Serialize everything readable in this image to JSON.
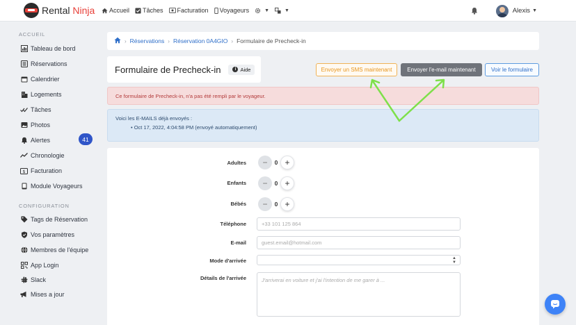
{
  "brand": {
    "name_part1": "Rental",
    "name_part2": "Ninja"
  },
  "topnav": {
    "home": "Accueil",
    "tasks": "Tâches",
    "billing": "Facturation",
    "guests": "Voyageurs"
  },
  "user": {
    "name": "Alexis"
  },
  "sidebar": {
    "section_accueil": "ACCUEIL",
    "section_config": "CONFIGURATION",
    "items": [
      {
        "label": "Tableau de bord",
        "icon": "bar-chart-icon"
      },
      {
        "label": "Réservations",
        "icon": "list-icon"
      },
      {
        "label": "Calendrier",
        "icon": "calendar-icon"
      },
      {
        "label": "Logements",
        "icon": "building-icon"
      },
      {
        "label": "Tâches",
        "icon": "check-icon"
      },
      {
        "label": "Photos",
        "icon": "image-icon"
      },
      {
        "label": "Alertes",
        "icon": "bell-icon",
        "badge": "41"
      },
      {
        "label": "Chronologie",
        "icon": "timeline-icon"
      },
      {
        "label": "Facturation",
        "icon": "money-icon"
      },
      {
        "label": "Module Voyageurs",
        "icon": "tablet-icon"
      }
    ],
    "config_items": [
      {
        "label": "Tags de Réservation",
        "icon": "tag-icon"
      },
      {
        "label": "Vos paramètres",
        "icon": "shield-icon"
      },
      {
        "label": "Membres de l'équipe",
        "icon": "globe-icon"
      },
      {
        "label": "App Login",
        "icon": "qr-icon"
      },
      {
        "label": "Slack",
        "icon": "slack-icon"
      },
      {
        "label": "Mises a jour",
        "icon": "megaphone-icon"
      }
    ]
  },
  "breadcrumb": {
    "reservations": "Réservations",
    "reservation": "Réservation 0A4GIO",
    "current": "Formulaire de Precheck-in"
  },
  "page": {
    "title": "Formulaire de Precheck-in",
    "help": "Aide",
    "btn_sms": "Envoyer un SMS maintenant",
    "btn_email": "Envoyer l'e-mail maintenant",
    "btn_view": "Voir le formulaire"
  },
  "alerts": {
    "danger": "Ce formulaire de Precheck-in, n'a pas été rempli par le voyageur.",
    "info_title": "Voici les E-MAILS déjà envoyés :",
    "info_item": "Oct 17, 2022, 4:04:58 PM (envoyé automatiquement)"
  },
  "form": {
    "adults_label": "Adultes",
    "adults_value": "0",
    "children_label": "Enfants",
    "children_value": "0",
    "babies_label": "Bébés",
    "babies_value": "0",
    "phone_label": "Téléphone",
    "phone_placeholder": "+33 101 125 864",
    "email_label": "E-mail",
    "email_placeholder": "guest.email@hotmail.com",
    "arrival_mode_label": "Mode d'arrivée",
    "arrival_details_label": "Détails de l'arrivée",
    "arrival_details_placeholder": "J'arriverai en voiture et j'ai l'intention de me garer à ..."
  },
  "colors": {
    "brand_red": "#e8413a",
    "link_blue": "#2f6fc9",
    "annotation_green": "#7ee04a",
    "badge_blue": "#2f55c8"
  }
}
